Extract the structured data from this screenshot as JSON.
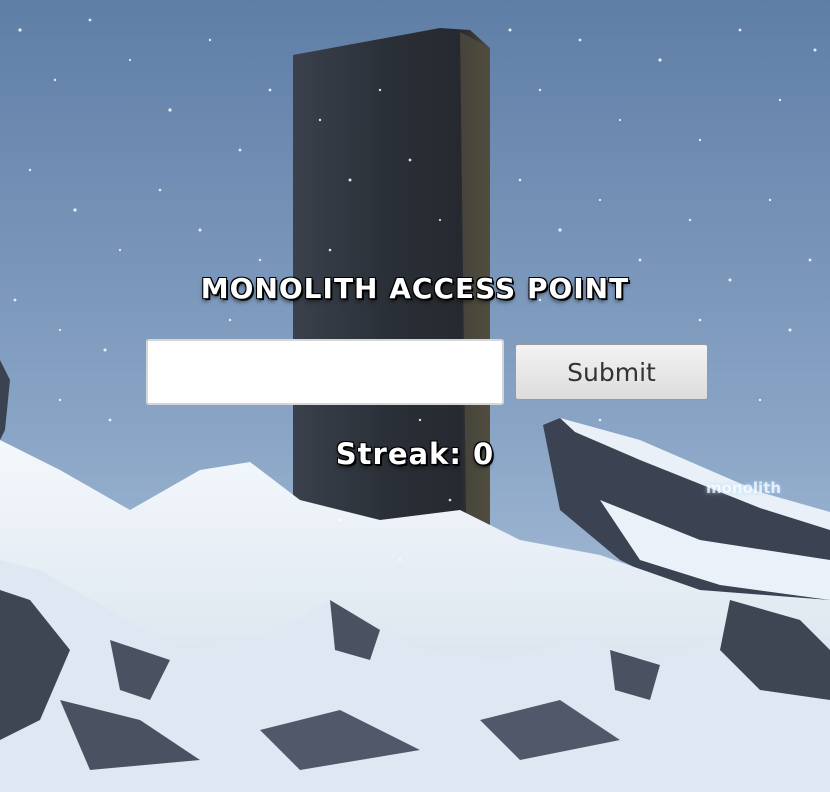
{
  "page": {
    "title": "Monolith Access Point",
    "code_input": {
      "value": "",
      "placeholder": ""
    },
    "submit_label": "Submit",
    "streak_label": "Streak:",
    "streak_value": "0",
    "watermark": "monolith"
  },
  "colors": {
    "sky_top": "#5f7ea6",
    "sky_bottom": "#a7bfd9",
    "monolith": "#2b2f36",
    "snow": "#eef3f9",
    "rock": "#3a4150",
    "heading_text": "#ffffff"
  }
}
